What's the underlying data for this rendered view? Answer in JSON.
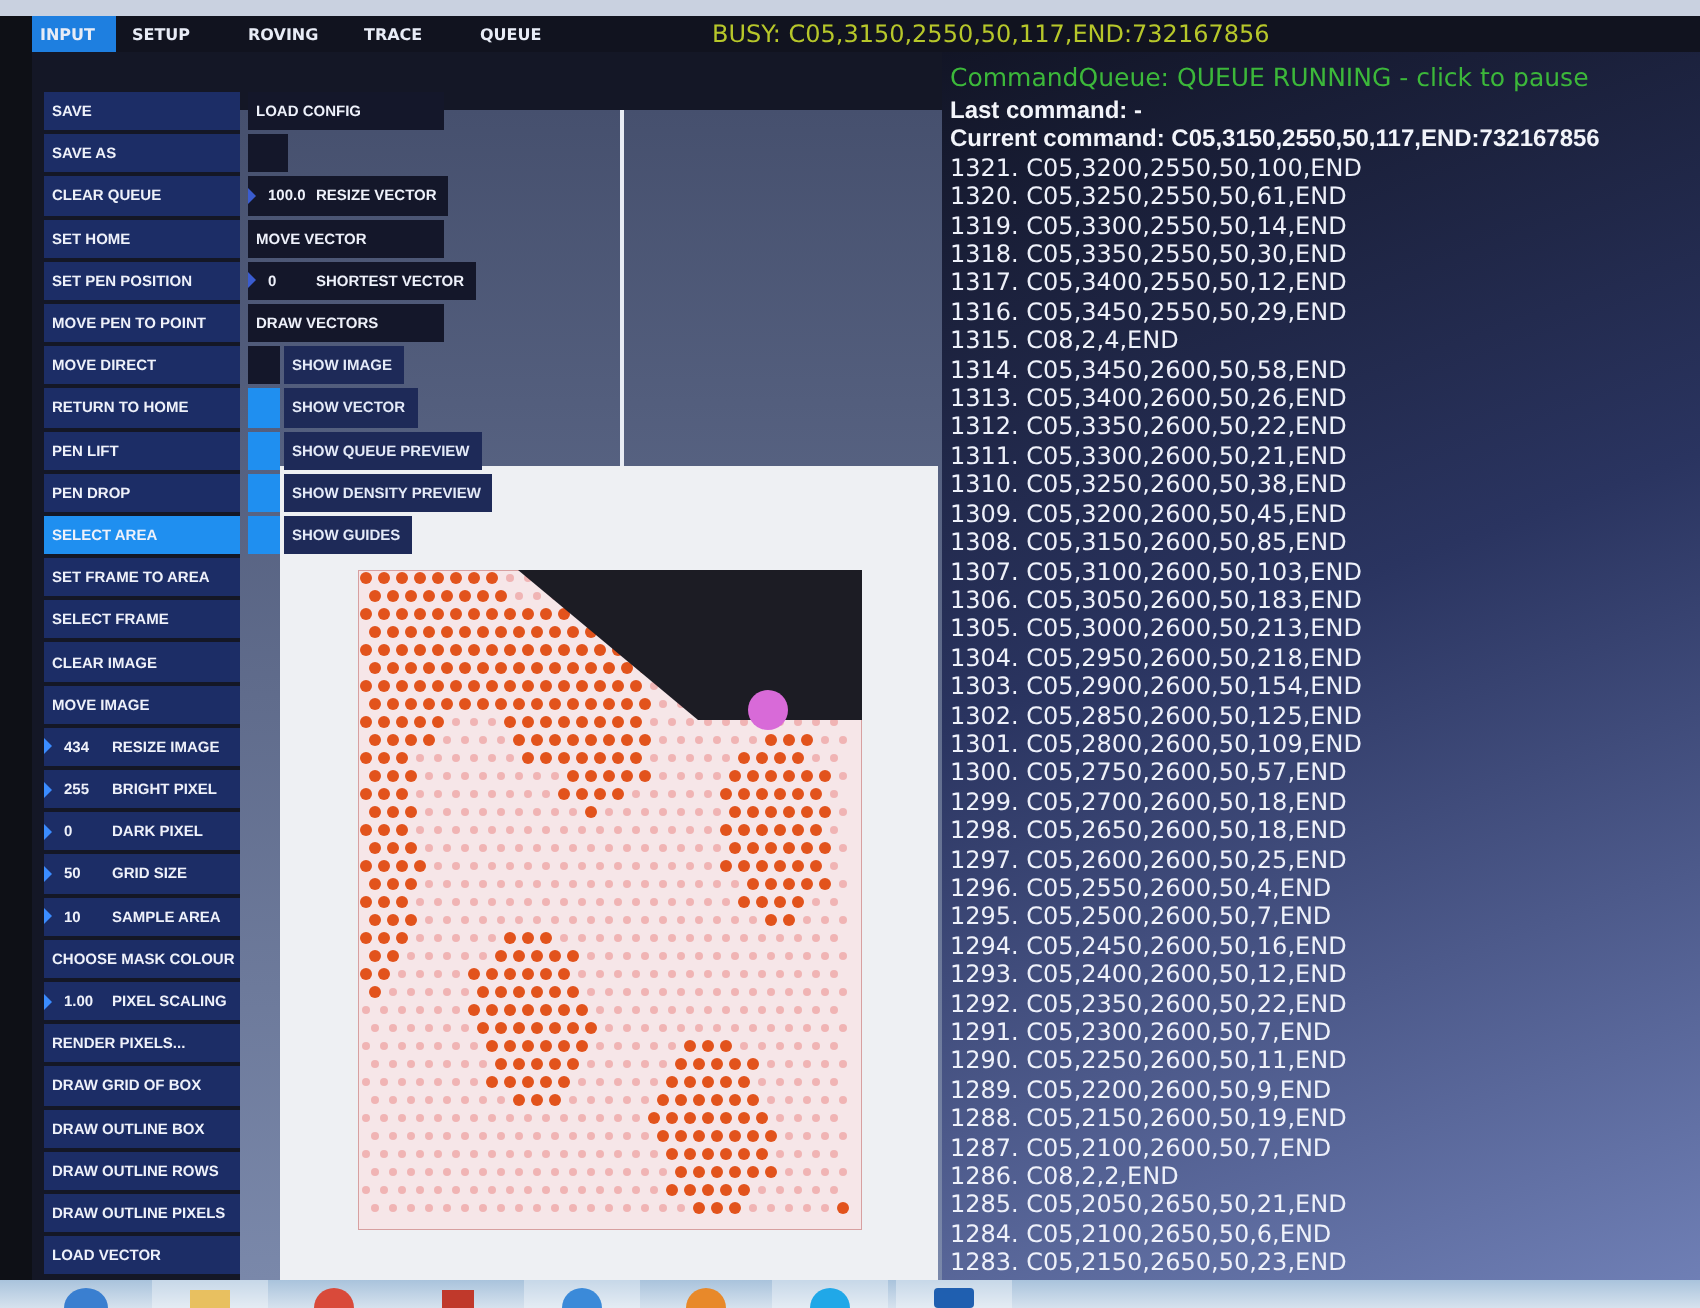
{
  "tabs": [
    {
      "label": "INPUT",
      "selected": true
    },
    {
      "label": "SETUP",
      "selected": false
    },
    {
      "label": "ROVING",
      "selected": false
    },
    {
      "label": "TRACE",
      "selected": false
    },
    {
      "label": "QUEUE",
      "selected": false
    }
  ],
  "busy_status": "BUSY: C05,3150,2550,50,117,END:732167856",
  "controls": [
    {
      "kind": "button",
      "label": "SAVE",
      "selected": false
    },
    {
      "kind": "button",
      "label": "SAVE AS",
      "selected": false
    },
    {
      "kind": "button",
      "label": "CLEAR QUEUE",
      "selected": false
    },
    {
      "kind": "button",
      "label": "SET HOME",
      "selected": false
    },
    {
      "kind": "button",
      "label": "SET PEN POSITION",
      "selected": false
    },
    {
      "kind": "button",
      "label": "MOVE PEN TO POINT",
      "selected": false
    },
    {
      "kind": "button",
      "label": "MOVE DIRECT",
      "selected": false
    },
    {
      "kind": "button",
      "label": "RETURN TO HOME",
      "selected": false
    },
    {
      "kind": "button",
      "label": "PEN LIFT",
      "selected": false
    },
    {
      "kind": "button",
      "label": "PEN DROP",
      "selected": false
    },
    {
      "kind": "button",
      "label": "SELECT AREA",
      "selected": true
    },
    {
      "kind": "button",
      "label": "SET FRAME TO AREA",
      "selected": false
    },
    {
      "kind": "button",
      "label": "SELECT FRAME",
      "selected": false
    },
    {
      "kind": "button",
      "label": "CLEAR IMAGE",
      "selected": false
    },
    {
      "kind": "button",
      "label": "MOVE IMAGE",
      "selected": false
    },
    {
      "kind": "numeric",
      "value": "434",
      "label": "RESIZE IMAGE",
      "selected": false
    },
    {
      "kind": "numeric",
      "value": "255",
      "label": "BRIGHT PIXEL",
      "selected": false
    },
    {
      "kind": "numeric",
      "value": "0",
      "label": "DARK PIXEL",
      "selected": false
    },
    {
      "kind": "numeric",
      "value": "50",
      "label": "GRID SIZE",
      "selected": false
    },
    {
      "kind": "numeric",
      "value": "10",
      "label": "SAMPLE AREA",
      "selected": false
    },
    {
      "kind": "button",
      "label": "CHOOSE MASK COLOUR",
      "selected": false
    },
    {
      "kind": "numeric",
      "value": "1.00",
      "label": "PIXEL SCALING",
      "selected": false
    },
    {
      "kind": "button",
      "label": "RENDER PIXELS...",
      "selected": false
    },
    {
      "kind": "button",
      "label": "DRAW GRID OF BOX",
      "selected": false
    },
    {
      "kind": "button",
      "label": "DRAW OUTLINE BOX",
      "selected": false
    },
    {
      "kind": "button",
      "label": "DRAW OUTLINE ROWS",
      "selected": false
    },
    {
      "kind": "button",
      "label": "DRAW OUTLINE PIXELS",
      "selected": false
    },
    {
      "kind": "button",
      "label": "LOAD VECTOR",
      "selected": false
    }
  ],
  "vector_controls": [
    {
      "kind": "button",
      "label": "LOAD CONFIG"
    },
    {
      "kind": "blank"
    },
    {
      "kind": "numeric",
      "value": "100.0",
      "label": "RESIZE VECTOR"
    },
    {
      "kind": "button",
      "label": "MOVE VECTOR"
    },
    {
      "kind": "numeric",
      "value": "0",
      "label": "SHORTEST VECTOR"
    },
    {
      "kind": "button",
      "label": "DRAW VECTORS"
    },
    {
      "kind": "toggle",
      "label": "SHOW IMAGE",
      "on": false
    },
    {
      "kind": "toggle",
      "label": "SHOW VECTOR",
      "on": true
    },
    {
      "kind": "toggle",
      "label": "SHOW QUEUE PREVIEW",
      "on": true
    },
    {
      "kind": "toggle",
      "label": "SHOW DENSITY PREVIEW",
      "on": true
    },
    {
      "kind": "toggle",
      "label": "SHOW GUIDES",
      "on": true
    }
  ],
  "queue": {
    "header": "CommandQueue: QUEUE RUNNING - click to pause",
    "last_command": "Last command: -",
    "current_command": "Current command: C05,3150,2550,50,117,END:732167856",
    "commands": [
      "1321. C05,3200,2550,50,100,END",
      "1320. C05,3250,2550,50,61,END",
      "1319. C05,3300,2550,50,14,END",
      "1318. C05,3350,2550,50,30,END",
      "1317. C05,3400,2550,50,12,END",
      "1316. C05,3450,2550,50,29,END",
      "1315. C08,2,4,END",
      "1314. C05,3450,2600,50,58,END",
      "1313. C05,3400,2600,50,26,END",
      "1312. C05,3350,2600,50,22,END",
      "1311. C05,3300,2600,50,21,END",
      "1310. C05,3250,2600,50,38,END",
      "1309. C05,3200,2600,50,45,END",
      "1308. C05,3150,2600,50,85,END",
      "1307. C05,3100,2600,50,103,END",
      "1306. C05,3050,2600,50,183,END",
      "1305. C05,3000,2600,50,213,END",
      "1304. C05,2950,2600,50,218,END",
      "1303. C05,2900,2600,50,154,END",
      "1302. C05,2850,2600,50,125,END",
      "1301. C05,2800,2600,50,109,END",
      "1300. C05,2750,2600,50,57,END",
      "1299. C05,2700,2600,50,18,END",
      "1298. C05,2650,2600,50,18,END",
      "1297. C05,2600,2600,50,25,END",
      "1296. C05,2550,2600,50,4,END",
      "1295. C05,2500,2600,50,7,END",
      "1294. C05,2450,2600,50,16,END",
      "1293. C05,2400,2600,50,12,END",
      "1292. C05,2350,2600,50,22,END",
      "1291. C05,2300,2600,50,7,END",
      "1290. C05,2250,2600,50,11,END",
      "1289. C05,2200,2600,50,9,END",
      "1288. C05,2150,2600,50,19,END",
      "1287. C05,2100,2600,50,7,END",
      "1286. C08,2,2,END",
      "1285. C05,2050,2650,50,21,END",
      "1284. C05,2100,2650,50,6,END",
      "1283. C05,2150,2650,50,23,END"
    ]
  }
}
